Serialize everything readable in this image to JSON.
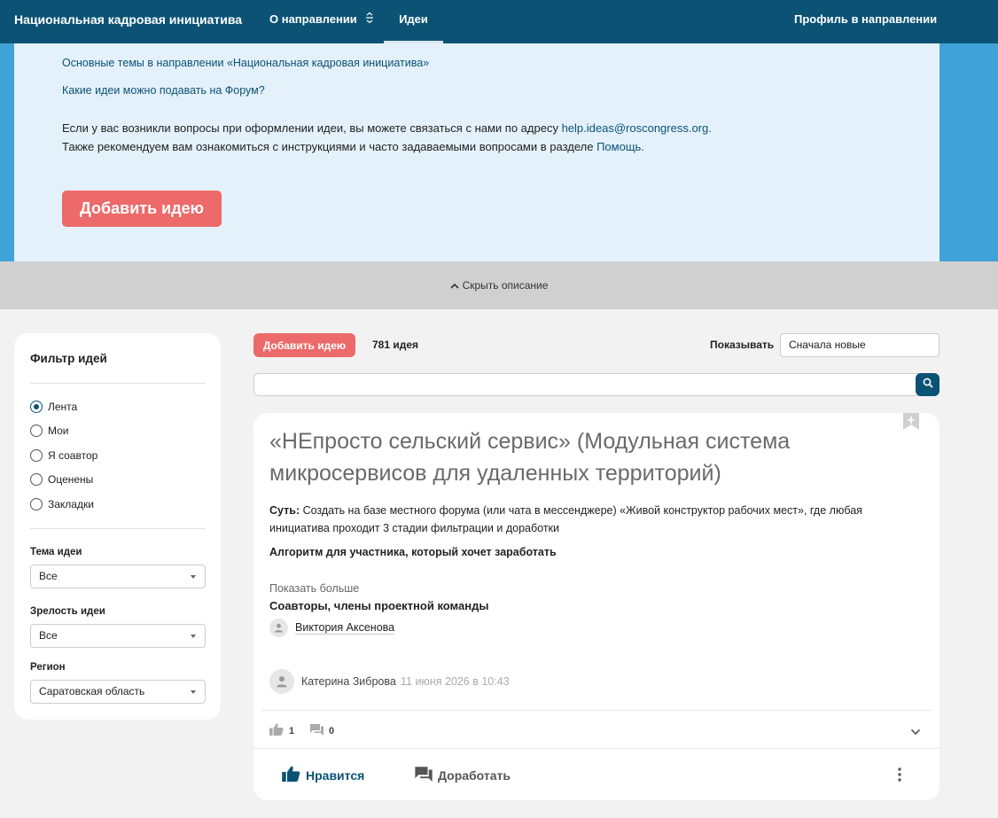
{
  "nav": {
    "brand": "Национальная кадровая инициатива",
    "about": "О направлении",
    "ideas": "Идеи",
    "profile": "Профиль в направлении"
  },
  "description": {
    "topics_link": "Основные темы в направлении «Национальная кадровая инициатива»",
    "ideas_link": "Какие идеи можно подавать на Форум?",
    "contact_prefix": "Если у вас возникли вопросы при оформлении идеи, вы можете связаться с нами по адресу ",
    "contact_email": "help.ideas@roscongress.org.",
    "help_prefix": "Также рекомендуем вам ознакомиться с инструкциями и часто задаваемыми вопросами в разделе ",
    "help_link": "Помощь.",
    "add_idea_button": "Добавить идею"
  },
  "hide_bar": {
    "label": "Скрыть описание"
  },
  "filter": {
    "title": "Фильтр идей",
    "options": [
      "Лента",
      "Мои",
      "Я соавтор",
      "Оценены",
      "Закладки"
    ],
    "selected": "Лента",
    "topic_label": "Тема идеи",
    "topic_value": "Все",
    "maturity_label": "Зрелость идеи",
    "maturity_value": "Все",
    "region_label": "Регион",
    "region_value": "Саратовская область"
  },
  "toolbar": {
    "add_idea_button": "Добавить идею",
    "count": "781 идея",
    "show_label": "Показывать",
    "sort_value": "Сначала новые",
    "search_placeholder": ""
  },
  "idea": {
    "title": "«НЕпросто сельский сервис» (Модульная система микросервисов для удаленных территорий)",
    "summary_label": "Суть:",
    "summary_text": " Создать на базе местного форума (или чата в мессенджере) «Живой конструктор рабочих мест», где любая инициатива проходит 3 стадии фильтрации и доработки",
    "algorithm": "Алгоритм для участника, который хочет заработать",
    "show_more": "Показать больше",
    "coauthors_title": "Соавторы, члены проектной команды",
    "coauthor_name": "Виктория Аксенова",
    "author_name": "Катерина Зиброва",
    "date": "11 июня 2026 в 10:43",
    "likes": "1",
    "comments": "0",
    "like_action": "Нравится",
    "improve_action": "Доработать"
  },
  "colors": {
    "nav_bg": "#0b5275",
    "accent_red": "#ec6a6a",
    "desc_bg": "#e4f1fb",
    "side_blue": "#3fa3d8"
  }
}
